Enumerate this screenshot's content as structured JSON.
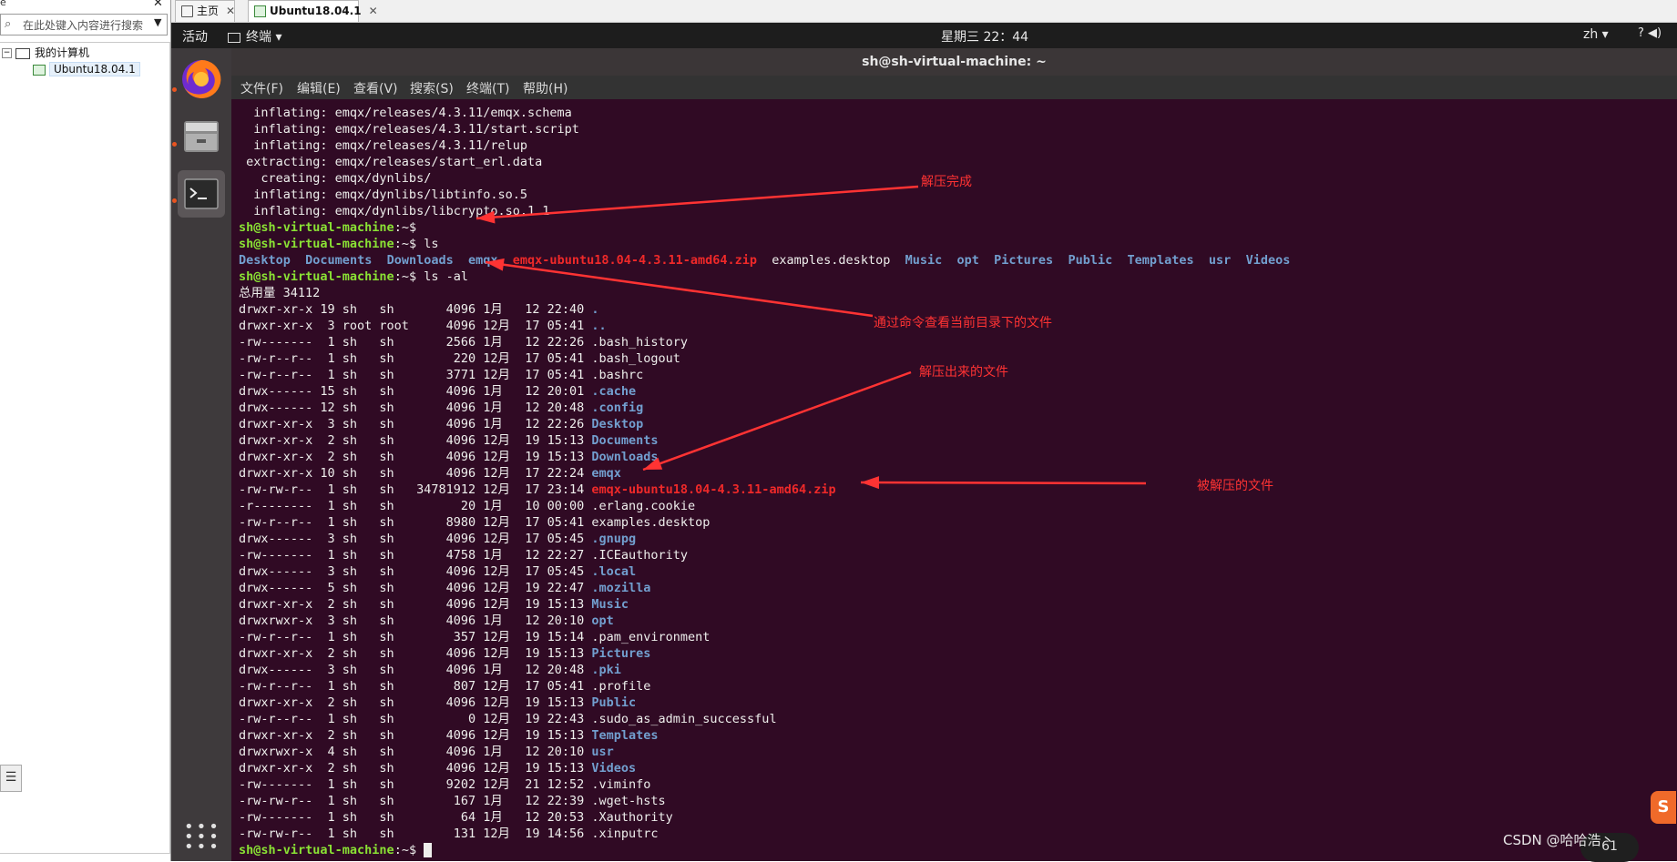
{
  "library": {
    "search_placeholder": "在此处键入内容进行搜索",
    "root_label": "我的计算机",
    "vm_label": "Ubuntu18.04.1",
    "top_fragment": "e",
    "close_glyph": "✕",
    "bottom_glyph": "☰"
  },
  "tabs": [
    {
      "label": "主页"
    },
    {
      "label": "Ubuntu18.04.1"
    }
  ],
  "topbar": {
    "activities": "活动",
    "app_menu": "终端",
    "clock": "星期三 22：44",
    "lang": "zh",
    "tray": "?  ◀)"
  },
  "window": {
    "title": "sh@sh-virtual-machine: ~"
  },
  "menu": [
    "文件(F)",
    "编辑(E)",
    "查看(V)",
    "搜索(S)",
    "终端(T)",
    "帮助(H)"
  ],
  "terminal": {
    "prompt": "sh@sh-virtual-machine",
    "pre_lines": [
      "  inflating: emqx/releases/4.3.11/emqx.schema",
      "  inflating: emqx/releases/4.3.11/start.script",
      "  inflating: emqx/releases/4.3.11/relup",
      " extracting: emqx/releases/start_erl.data",
      "   creating: emqx/dynlibs/",
      "  inflating: emqx/dynlibs/libtinfo.so.5",
      "  inflating: emqx/dynlibs/libcrypto.so.1.1"
    ],
    "cmd1": ":~$",
    "cmd2": ":~$ ls",
    "ls_output": [
      {
        "name": "Desktop",
        "cls": "blu"
      },
      {
        "name": "Documents",
        "cls": "blu"
      },
      {
        "name": "Downloads",
        "cls": "blu"
      },
      {
        "name": "emqx",
        "cls": "blu"
      },
      {
        "name": "emqx-ubuntu18.04-4.3.11-amd64.zip",
        "cls": "red"
      },
      {
        "name": "examples.desktop",
        "cls": ""
      },
      {
        "name": "Music",
        "cls": "blu"
      },
      {
        "name": "opt",
        "cls": "blu"
      },
      {
        "name": "Pictures",
        "cls": "blu"
      },
      {
        "name": "Public",
        "cls": "blu"
      },
      {
        "name": "Templates",
        "cls": "blu"
      },
      {
        "name": "usr",
        "cls": "blu"
      },
      {
        "name": "Videos",
        "cls": "blu"
      }
    ],
    "cmd3": ":~$ ls -al",
    "total": "总用量 34112",
    "rows": [
      {
        "meta": "drwxr-xr-x 19 sh   sh       4096 1月   12 22:40 ",
        "name": ".",
        "cls": "blu"
      },
      {
        "meta": "drwxr-xr-x  3 root root     4096 12月  17 05:41 ",
        "name": "..",
        "cls": "blu"
      },
      {
        "meta": "-rw-------  1 sh   sh       2566 1月   12 22:26 ",
        "name": ".bash_history",
        "cls": ""
      },
      {
        "meta": "-rw-r--r--  1 sh   sh        220 12月  17 05:41 ",
        "name": ".bash_logout",
        "cls": ""
      },
      {
        "meta": "-rw-r--r--  1 sh   sh       3771 12月  17 05:41 ",
        "name": ".bashrc",
        "cls": ""
      },
      {
        "meta": "drwx------ 15 sh   sh       4096 1月   12 20:01 ",
        "name": ".cache",
        "cls": "blu"
      },
      {
        "meta": "drwx------ 12 sh   sh       4096 1月   12 20:48 ",
        "name": ".config",
        "cls": "blu"
      },
      {
        "meta": "drwxr-xr-x  3 sh   sh       4096 1月   12 22:26 ",
        "name": "Desktop",
        "cls": "blu"
      },
      {
        "meta": "drwxr-xr-x  2 sh   sh       4096 12月  19 15:13 ",
        "name": "Documents",
        "cls": "blu"
      },
      {
        "meta": "drwxr-xr-x  2 sh   sh       4096 12月  19 15:13 ",
        "name": "Downloads",
        "cls": "blu"
      },
      {
        "meta": "drwxr-xr-x 10 sh   sh       4096 12月  17 22:24 ",
        "name": "emqx",
        "cls": "blu"
      },
      {
        "meta": "-rw-rw-r--  1 sh   sh   34781912 12月  17 23:14 ",
        "name": "emqx-ubuntu18.04-4.3.11-amd64.zip",
        "cls": "red"
      },
      {
        "meta": "-r--------  1 sh   sh         20 1月   10 00:00 ",
        "name": ".erlang.cookie",
        "cls": ""
      },
      {
        "meta": "-rw-r--r--  1 sh   sh       8980 12月  17 05:41 ",
        "name": "examples.desktop",
        "cls": ""
      },
      {
        "meta": "drwx------  3 sh   sh       4096 12月  17 05:45 ",
        "name": ".gnupg",
        "cls": "blu"
      },
      {
        "meta": "-rw-------  1 sh   sh       4758 1月   12 22:27 ",
        "name": ".ICEauthority",
        "cls": ""
      },
      {
        "meta": "drwx------  3 sh   sh       4096 12月  17 05:45 ",
        "name": ".local",
        "cls": "blu"
      },
      {
        "meta": "drwx------  5 sh   sh       4096 12月  19 22:47 ",
        "name": ".mozilla",
        "cls": "blu"
      },
      {
        "meta": "drwxr-xr-x  2 sh   sh       4096 12月  19 15:13 ",
        "name": "Music",
        "cls": "blu"
      },
      {
        "meta": "drwxrwxr-x  3 sh   sh       4096 1月   12 20:10 ",
        "name": "opt",
        "cls": "blu"
      },
      {
        "meta": "-rw-r--r--  1 sh   sh        357 12月  19 15:14 ",
        "name": ".pam_environment",
        "cls": ""
      },
      {
        "meta": "drwxr-xr-x  2 sh   sh       4096 12月  19 15:13 ",
        "name": "Pictures",
        "cls": "blu"
      },
      {
        "meta": "drwx------  3 sh   sh       4096 1月   12 20:48 ",
        "name": ".pki",
        "cls": "blu"
      },
      {
        "meta": "-rw-r--r--  1 sh   sh        807 12月  17 05:41 ",
        "name": ".profile",
        "cls": ""
      },
      {
        "meta": "drwxr-xr-x  2 sh   sh       4096 12月  19 15:13 ",
        "name": "Public",
        "cls": "blu"
      },
      {
        "meta": "-rw-r--r--  1 sh   sh          0 12月  19 22:43 ",
        "name": ".sudo_as_admin_successful",
        "cls": ""
      },
      {
        "meta": "drwxr-xr-x  2 sh   sh       4096 12月  19 15:13 ",
        "name": "Templates",
        "cls": "blu"
      },
      {
        "meta": "drwxrwxr-x  4 sh   sh       4096 1月   12 20:10 ",
        "name": "usr",
        "cls": "blu"
      },
      {
        "meta": "drwxr-xr-x  2 sh   sh       4096 12月  19 15:13 ",
        "name": "Videos",
        "cls": "blu"
      },
      {
        "meta": "-rw-------  1 sh   sh       9202 12月  21 12:52 ",
        "name": ".viminfo",
        "cls": ""
      },
      {
        "meta": "-rw-rw-r--  1 sh   sh        167 1月   12 22:39 ",
        "name": ".wget-hsts",
        "cls": ""
      },
      {
        "meta": "-rw-------  1 sh   sh         64 1月   12 20:53 ",
        "name": ".Xauthority",
        "cls": ""
      },
      {
        "meta": "-rw-rw-r--  1 sh   sh        131 12月  19 14:56 ",
        "name": ".xinputrc",
        "cls": ""
      }
    ],
    "final_prompt": ":~$ "
  },
  "annotations": {
    "unzip_done": "解压完成",
    "list_cmd": "通过命令查看当前目录下的文件",
    "extracted": "解压出来的文件",
    "zipped": "被解压的文件",
    "color": "#ff3333"
  },
  "watermark": "CSDN @哈哈浩丶",
  "overlay": {
    "sogou": "S",
    "net": "61"
  },
  "colors": {
    "prompt": "#8ae234",
    "dir": "#729fcf",
    "archive": "#ef2929",
    "bg": "#300a24"
  }
}
